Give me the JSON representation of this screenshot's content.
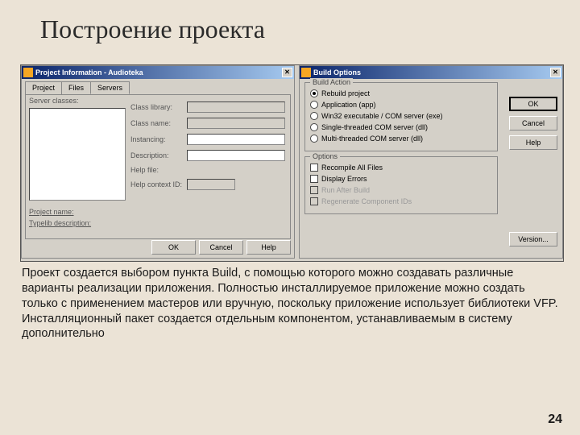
{
  "slide": {
    "title": "Построение проекта",
    "body": "Проект создается выбором пункта Build, с помощью которого можно создавать различные варианты реализации приложения. Полностью инсталлируемое приложение можно создать только с применением мастеров или вручную, поскольку приложение использует библиотеки VFP. Инсталляционный пакет создается отдельным компонентом, устанавливаемым в систему дополнительно",
    "pagenum": "24"
  },
  "leftWin": {
    "title": "Project Information - Audioteka",
    "tabs": {
      "t1": "Project",
      "t2": "Files",
      "t3": "Servers"
    },
    "labels": {
      "serverClasses": "Server classes:",
      "classLibrary": "Class library:",
      "className": "Class name:",
      "instancing": "Instancing:",
      "description": "Description:",
      "helpFile": "Help file:",
      "helpContextId": "Help context ID:",
      "projectName": "Project name:",
      "typelibDesc": "Typelib description:"
    },
    "buttons": {
      "ok": "OK",
      "cancel": "Cancel",
      "help": "Help"
    }
  },
  "rightWin": {
    "title": "Build Options",
    "groups": {
      "action": "Build Action",
      "options": "Options"
    },
    "radios": {
      "rebuild": "Rebuild project",
      "app": "Application (app)",
      "exe": "Win32 executable / COM server (exe)",
      "single": "Single-threaded COM server (dll)",
      "multi": "Multi-threaded COM server (dll)"
    },
    "checks": {
      "recompile": "Recompile All Files",
      "display": "Display Errors",
      "runAfter": "Run After Build",
      "regen": "Regenerate Component IDs"
    },
    "buttons": {
      "ok": "OK",
      "cancel": "Cancel",
      "help": "Help",
      "version": "Version..."
    }
  }
}
